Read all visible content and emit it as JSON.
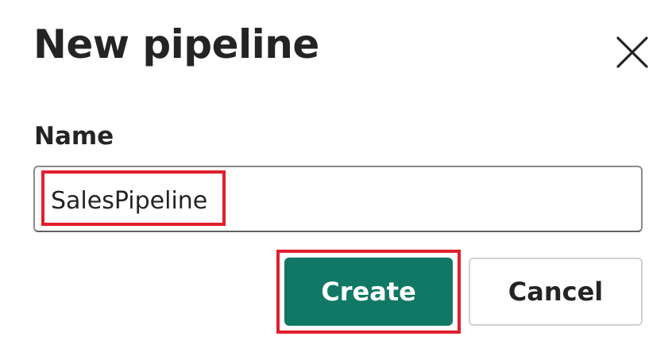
{
  "dialog": {
    "title": "New pipeline",
    "close_icon": "close-icon"
  },
  "form": {
    "name_label": "Name",
    "name_value": "SalesPipeline"
  },
  "actions": {
    "create_label": "Create",
    "cancel_label": "Cancel"
  },
  "colors": {
    "primary": "#117865",
    "highlight": "#e11f2d",
    "text": "#242424"
  }
}
